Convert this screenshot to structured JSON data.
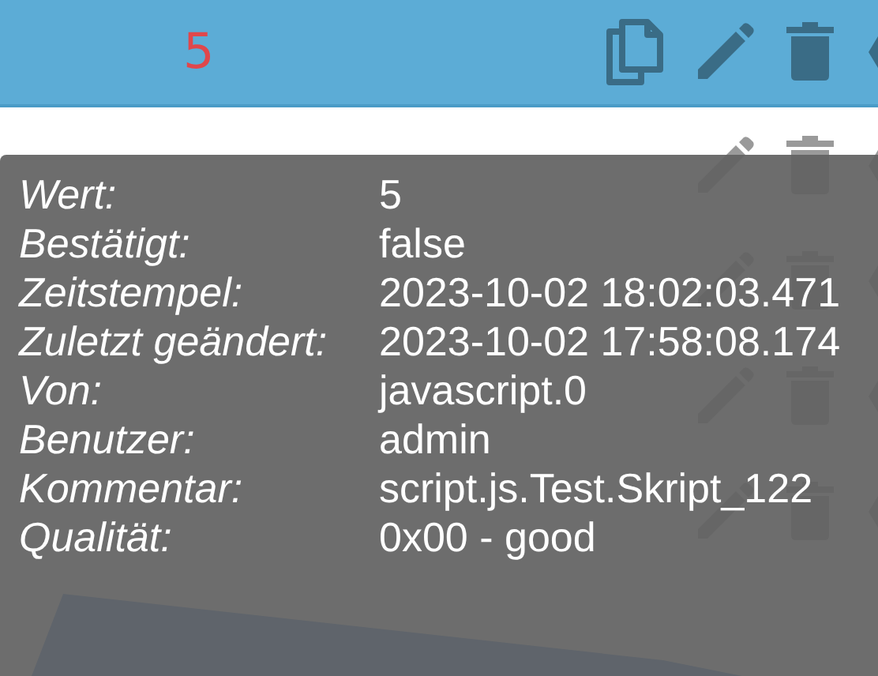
{
  "header": {
    "value": "5"
  },
  "tooltip": [
    {
      "label": "Wert:",
      "value": "5"
    },
    {
      "label": "Bestätigt:",
      "value": "false"
    },
    {
      "label": "Zeitstempel:",
      "value": "2023-10-02 18:02:03.471"
    },
    {
      "label": "Zuletzt geändert:",
      "value": "2023-10-02 17:58:08.174"
    },
    {
      "label": "Von:",
      "value": "javascript.0"
    },
    {
      "label": "Benutzer:",
      "value": "admin"
    },
    {
      "label": "Kommentar:",
      "value": "script.js.Test.Skript_122"
    },
    {
      "label": "Qualität:",
      "value": "0x00 - good"
    }
  ]
}
